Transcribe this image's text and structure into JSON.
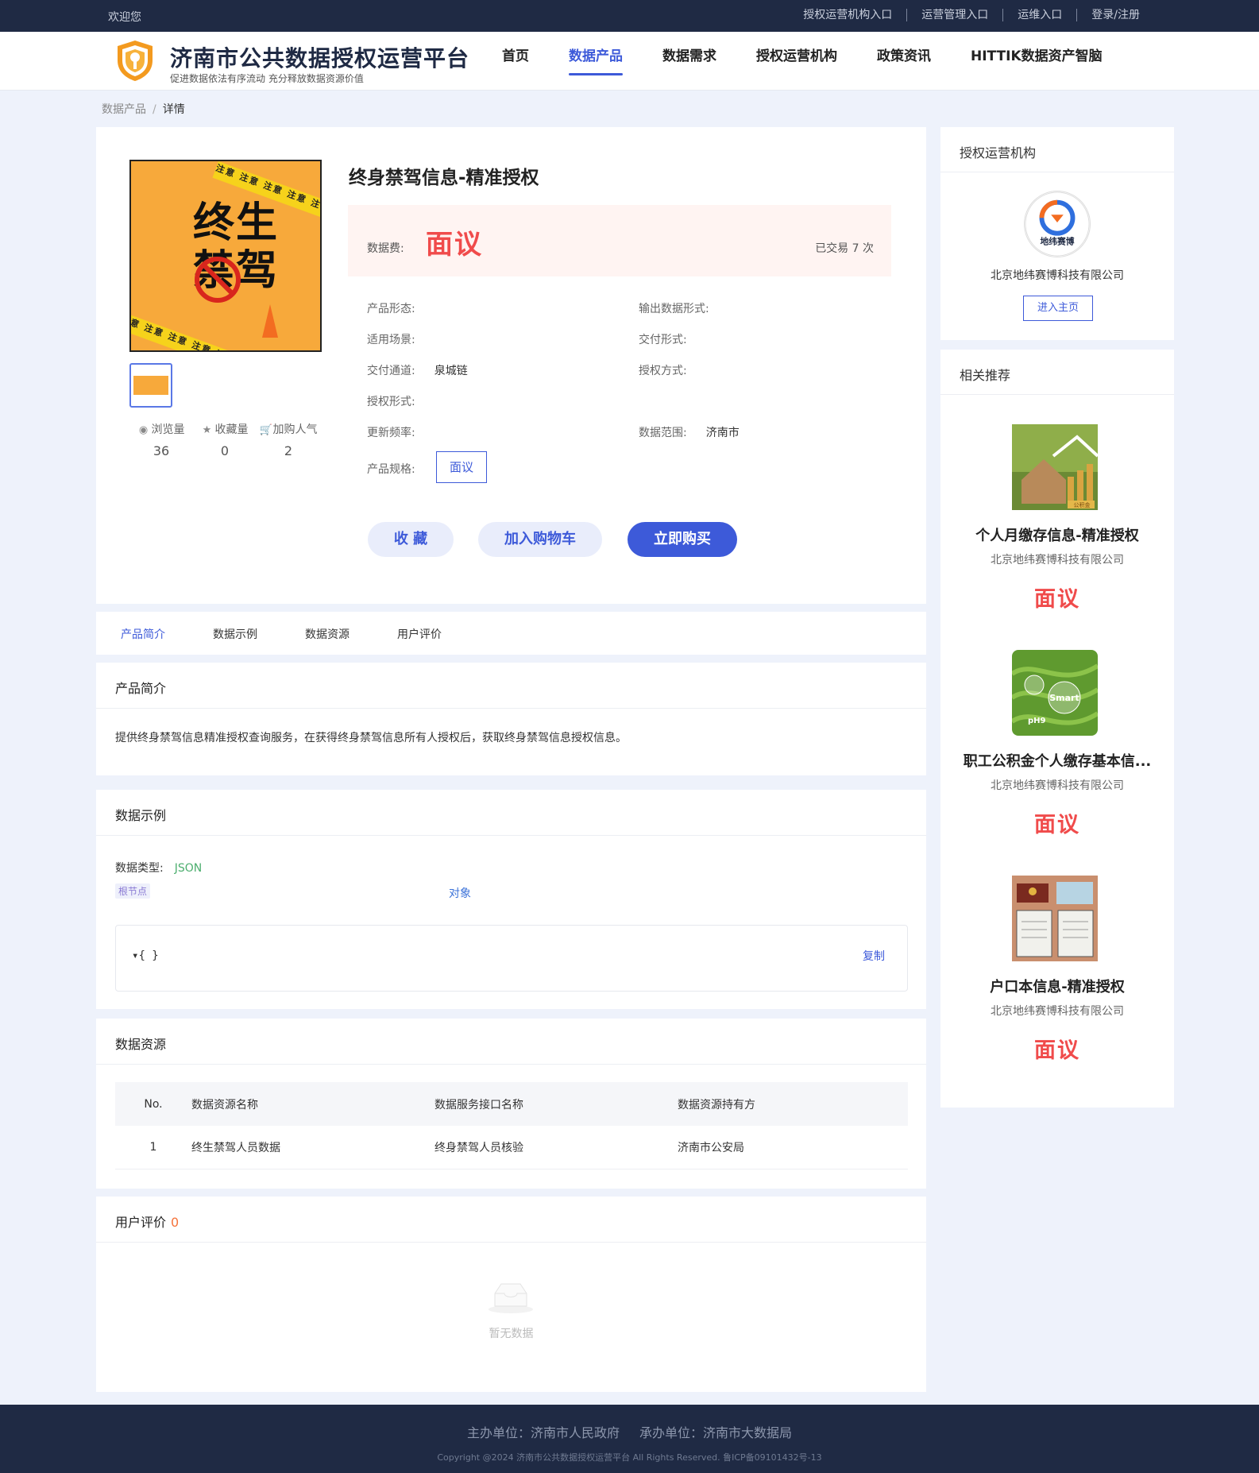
{
  "topbar": {
    "welcome": "欢迎您",
    "links": [
      "授权运营机构入口",
      "运营管理入口",
      "运维入口",
      "登录/注册"
    ]
  },
  "header": {
    "title": "济南市公共数据授权运营平台",
    "subtitle": "促进数据依法有序流动 充分释放数据资源价值",
    "nav": [
      "首页",
      "数据产品",
      "数据需求",
      "授权运营机构",
      "政策资讯",
      "HITTIK数据资产智脑"
    ],
    "active_nav": "数据产品"
  },
  "breadcrumb": {
    "parent": "数据产品",
    "sep": "/",
    "current": "详情"
  },
  "product": {
    "image_text": "终生禁驾",
    "image_tape": "注意 注意 注意 注意 注意",
    "title": "终身禁驾信息-精准授权",
    "price_label": "数据费:",
    "price": "面议",
    "deal_count": "已交易 7 次",
    "stats": [
      {
        "label": "浏览量",
        "value": "36",
        "icon": "eye-icon"
      },
      {
        "label": "收藏量",
        "value": "0",
        "icon": "star-icon"
      },
      {
        "label": "加购人气",
        "value": "2",
        "icon": "cart-icon"
      }
    ],
    "attributes": {
      "form_label": "产品形态:",
      "form_value": "",
      "output_label": "输出数据形式:",
      "output_value": "",
      "scene_label": "适用场景:",
      "scene_value": "",
      "delivery_form_label": "交付形式:",
      "delivery_form_value": "",
      "channel_label": "交付通道:",
      "channel_value": "泉城链",
      "auth_method_label": "授权方式:",
      "auth_method_value": "",
      "auth_form_label": "授权形式:",
      "auth_form_value": "",
      "freq_label": "更新频率:",
      "freq_value": "",
      "range_label": "数据范围:",
      "range_value": "济南市",
      "spec_label": "产品规格:",
      "spec_value": "面议"
    },
    "buttons": {
      "favorite": "收 藏",
      "add_cart": "加入购物车",
      "buy": "立即购买"
    }
  },
  "tabs": [
    "产品简介",
    "数据示例",
    "数据资源",
    "用户评价"
  ],
  "intro": {
    "title": "产品简介",
    "text": "提供终身禁驾信息精准授权查询服务，在获得终身禁驾信息所有人授权后，获取终身禁驾信息授权信息。"
  },
  "sample": {
    "title": "数据示例",
    "type_label": "数据类型:",
    "type_value": "JSON",
    "root_node": "根节点",
    "object_label": "对象",
    "code": "{ }",
    "copy": "复制"
  },
  "resources": {
    "title": "数据资源",
    "columns": [
      "No.",
      "数据资源名称",
      "数据服务接口名称",
      "数据资源持有方"
    ],
    "rows": [
      [
        "1",
        "终生禁驾人员数据",
        "终身禁驾人员核验",
        "济南市公安局"
      ]
    ]
  },
  "reviews": {
    "title": "用户评价",
    "count": "0",
    "empty": "暂无数据"
  },
  "org": {
    "title": "授权运营机构",
    "logo_text": "地纬赛博",
    "name": "北京地纬赛博科技有限公司",
    "button": "进入主页"
  },
  "recommend": {
    "title": "相关推荐",
    "items": [
      {
        "name": "个人月缴存信息-精准授权",
        "company": "北京地纬赛博科技有限公司",
        "price": "面议",
        "image": "house-coins-image",
        "image_label": "公积金"
      },
      {
        "name": "职工公积金个人缴存基本信...",
        "company": "北京地纬赛博科技有限公司",
        "price": "面议",
        "image": "smart-agriculture-image",
        "image_label": "Smart",
        "image_label2": "pH9"
      },
      {
        "name": "户口本信息-精准授权",
        "company": "北京地纬赛博科技有限公司",
        "price": "面议",
        "image": "household-register-image"
      }
    ]
  },
  "footer": {
    "sponsor": "主办单位：济南市人民政府",
    "organizer": "承办单位：济南市大数据局",
    "copyright": "Copyright @2024 济南市公共数据授权运营平台 All Rights Reserved. 鲁ICP备09101432号-13"
  },
  "colors": {
    "primary": "#3d5ad9",
    "price": "#f04b4b",
    "dark": "#1f2a44",
    "json": "#4cae6e"
  }
}
